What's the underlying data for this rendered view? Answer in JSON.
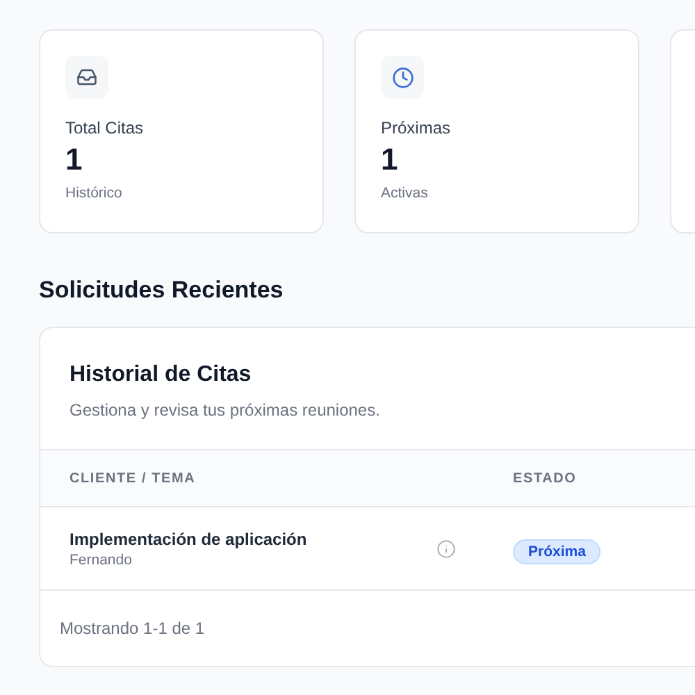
{
  "stats": [
    {
      "kind": "inbox",
      "label": "Total Citas",
      "value": "1",
      "caption": "Histórico"
    },
    {
      "kind": "clock",
      "label": "Próximas",
      "value": "1",
      "caption": "Activas"
    }
  ],
  "section_title": "Solicitudes Recientes",
  "table_card": {
    "title": "Historial de Citas",
    "subtitle": "Gestiona y revisa tus próximas reuniones.",
    "columns": [
      "CLIENTE / TEMA",
      "ESTADO"
    ],
    "rows": [
      {
        "topic": "Implementación de aplicación",
        "client": "Fernando",
        "status": "Próxima",
        "kind": "upcoming"
      }
    ],
    "footer": "Mostrando 1-1 de 1"
  }
}
